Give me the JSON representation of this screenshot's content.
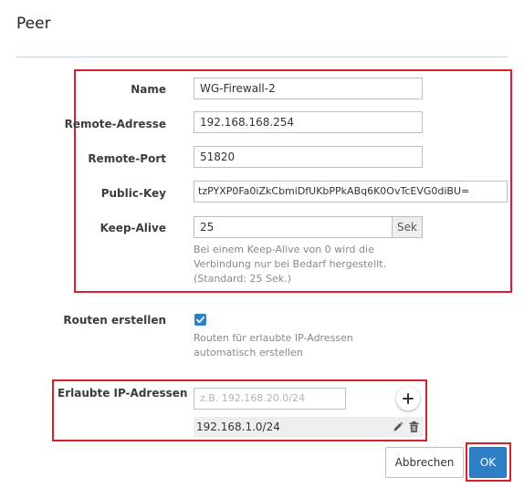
{
  "dialog": {
    "title": "Peer"
  },
  "form": {
    "name": {
      "label": "Name",
      "value": "WG-Firewall-2"
    },
    "remote_address": {
      "label": "Remote-Adresse",
      "value": "192.168.168.254"
    },
    "remote_port": {
      "label": "Remote-Port",
      "value": "51820"
    },
    "public_key": {
      "label": "Public-Key",
      "value": "tzPYXP0Fa0iZkCbmiDfUKbPPkABq6K0OvTcEVG0diBU="
    },
    "keep_alive": {
      "label": "Keep-Alive",
      "value": "25",
      "unit": "Sek",
      "help_line1": "Bei einem Keep-Alive von 0 wird die",
      "help_line2": "Verbindung nur bei Bedarf hergestellt.",
      "help_line3": "(Standard: 25 Sek.)"
    },
    "routes": {
      "label": "Routen erstellen",
      "checked": true,
      "help_line1": "Routen für erlaubte IP-Adressen",
      "help_line2": "automatisch erstellen"
    },
    "allowed_ips": {
      "label": "Erlaubte IP-Adressen",
      "placeholder": "z.B. 192.168.20.0/24",
      "entries": [
        "192.168.1.0/24"
      ]
    }
  },
  "buttons": {
    "cancel": "Abbrechen",
    "ok": "OK"
  },
  "icons": {
    "add": "plus-icon",
    "edit": "pencil-icon",
    "delete": "trash-icon",
    "check": "checkmark-icon"
  },
  "colors": {
    "highlight": "#d9202a",
    "accent": "#2e7fc6"
  }
}
